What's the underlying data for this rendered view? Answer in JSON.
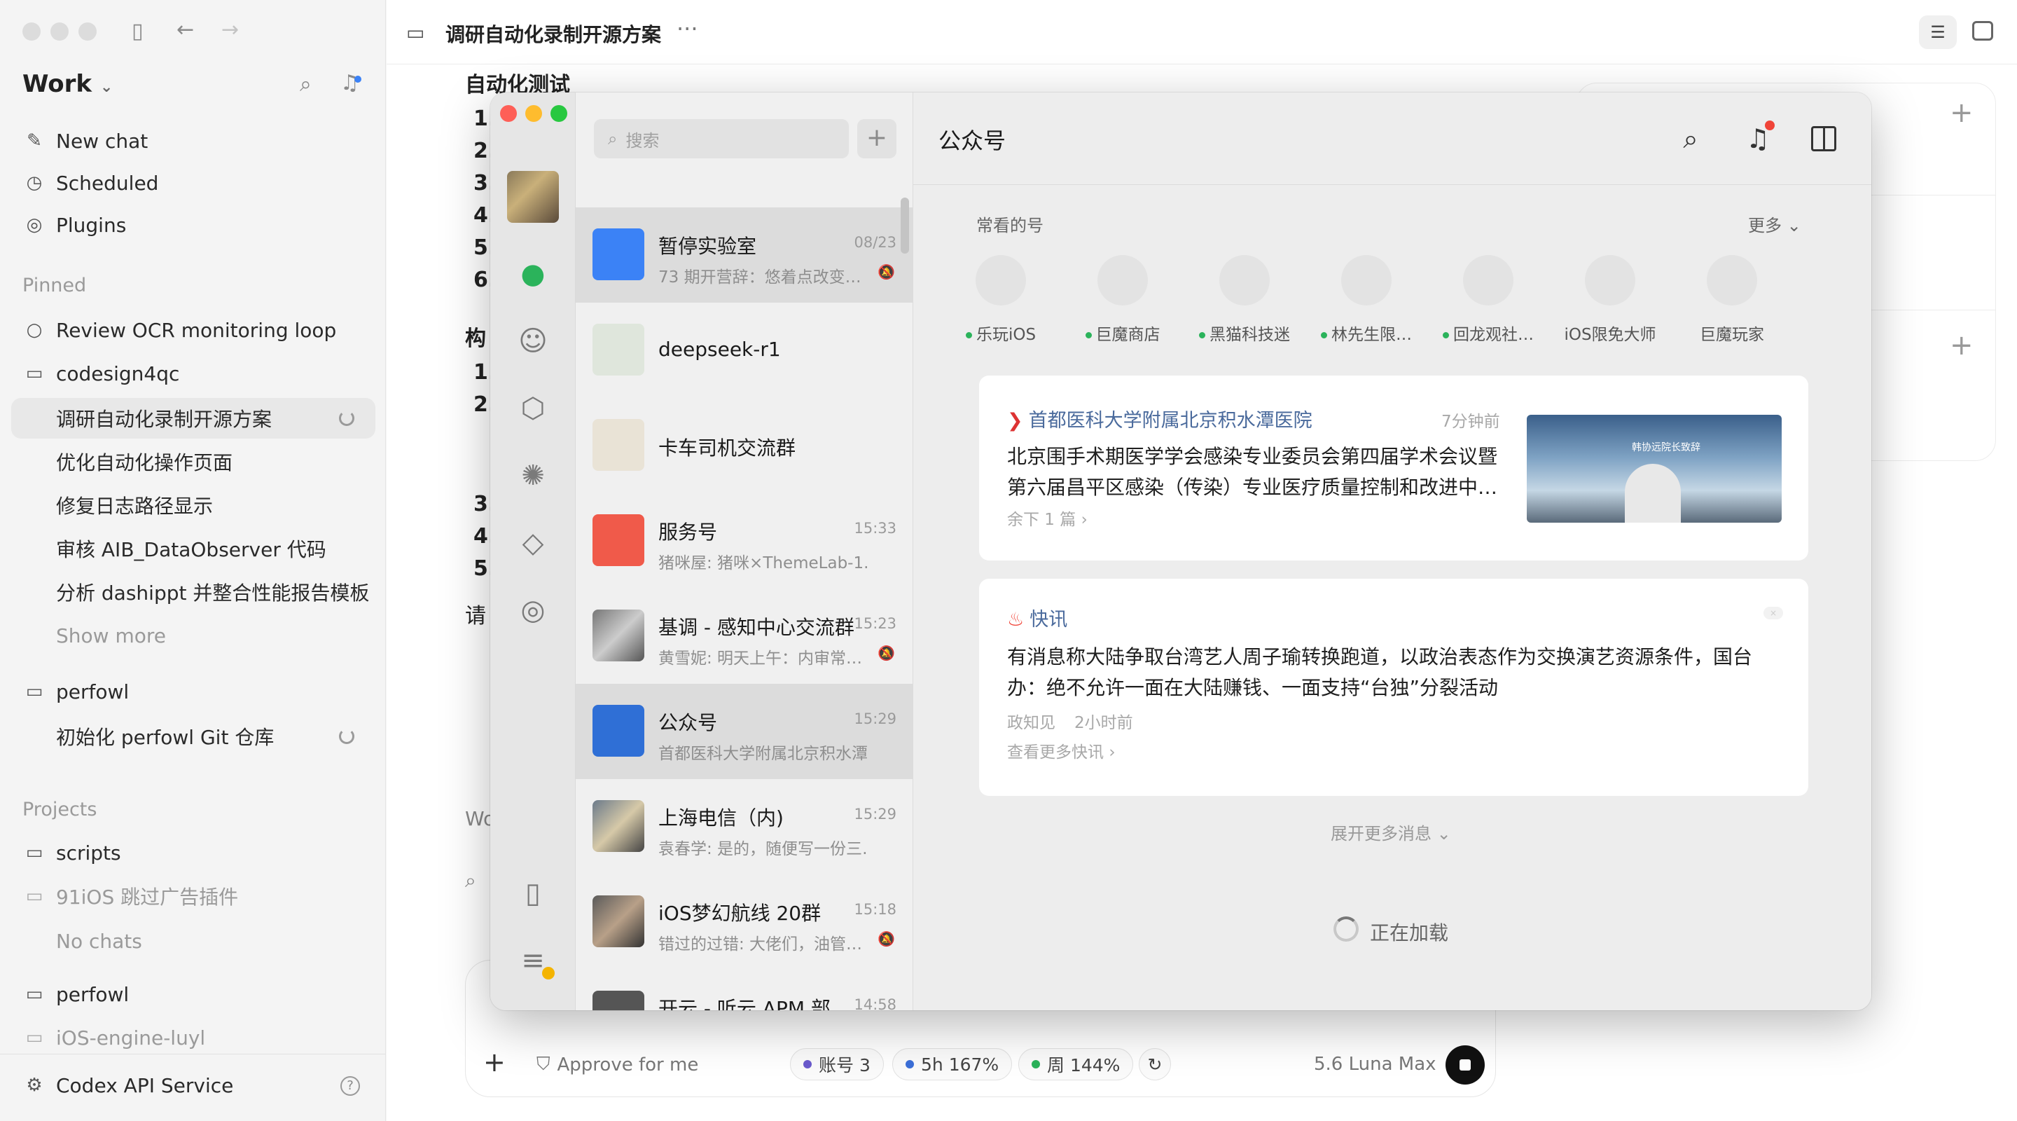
{
  "app": {
    "workspace": "Work",
    "nav": {
      "new_chat": "New chat",
      "scheduled": "Scheduled",
      "plugins": "Plugins"
    },
    "pinned_label": "Pinned",
    "pinned": {
      "review": "Review OCR monitoring loop",
      "folder": "codesign4qc",
      "children": [
        "调研自动化录制开源方案",
        "优化自动化操作页面",
        "修复日志路径显示",
        "审核 AIB_DataObserver 代码",
        "分析 dashippt 并整合性能报告模板"
      ],
      "show_more": "Show more"
    },
    "perfowl": {
      "folder": "perfowl",
      "child": "初始化 perfowl Git 仓库"
    },
    "projects_label": "Projects",
    "projects": {
      "scripts": "scripts",
      "ios_plugin": "91iOS 跳过广告插件",
      "no_chats": "No chats",
      "perfowl": "perfowl",
      "ios_engine": "iOS-engine-luyl"
    },
    "footer": "Codex API Service"
  },
  "doc": {
    "title": "调研自动化录制开源方案",
    "heading": "自动化测试",
    "list1": [
      "1.",
      "2.",
      "3.",
      "4.",
      "5.",
      "6."
    ],
    "heading2": "构",
    "list2": [
      "1.",
      "2."
    ],
    "list3": [
      "3.",
      "4.",
      "5."
    ],
    "trailing": "请",
    "wo": "Wo"
  },
  "composer": {
    "approve": "Approve for me",
    "chips": [
      {
        "label": "账号 3",
        "color": "#6a5acd"
      },
      {
        "label": "5h 167%",
        "color": "#3b6fd8"
      },
      {
        "label": "周 144%",
        "color": "#2bb35b"
      }
    ],
    "model": "5.6 Luna Max"
  },
  "wechat": {
    "search_placeholder": "搜索",
    "conversations": [
      {
        "name": "暂停实验室",
        "time": "08/23",
        "preview": "73 期开营辞：悠着点改变…",
        "muted": true,
        "selected": true
      },
      {
        "name": "deepseek-r1",
        "time": "",
        "preview": "",
        "muted": false
      },
      {
        "name": "卡车司机交流群",
        "time": "",
        "preview": "",
        "muted": false
      },
      {
        "name": "服务号",
        "time": "15:33",
        "preview": "猪咪屋: 猪咪×ThemeLab-1.7…",
        "muted": false
      },
      {
        "name": "基调 - 感知中心交流群",
        "time": "15:23",
        "preview": "黄雪妮: 明天上午：内审常…",
        "muted": true
      },
      {
        "name": "公众号",
        "time": "15:29",
        "preview": "首都医科大学附属北京积水潭…",
        "muted": false,
        "selected": true
      },
      {
        "name": "上海电信（内)",
        "time": "15:29",
        "preview": "袁春学: 是的，随便写一份三…",
        "muted": false
      },
      {
        "name": "iOS梦幻航线 20群",
        "time": "15:18",
        "preview": "错过的过错: 大佬们，油管…",
        "muted": true
      },
      {
        "name": "开云 - 听云 APM 部…",
        "time": "14:58",
        "preview": "",
        "muted": false
      }
    ],
    "main_title": "公众号",
    "frequent_label": "常看的号",
    "more_label": "更多",
    "accounts": [
      {
        "name": "乐玩iOS",
        "dot": true
      },
      {
        "name": "巨魔商店",
        "dot": true
      },
      {
        "name": "黑猫科技迷",
        "dot": true
      },
      {
        "name": "林先生限…",
        "dot": true
      },
      {
        "name": "回龙观社…",
        "dot": true
      },
      {
        "name": "iOS限免大师",
        "dot": false
      },
      {
        "name": "巨魔玩家",
        "dot": false
      }
    ],
    "article_card": {
      "source": "首都医科大学附属北京积水潭医院",
      "time": "7分钟前",
      "line1": "北京围手术期医学学会感染专业委员会第四届学术会议暨",
      "line2": "第六届昌平区感染（传染）专业医疗质量控制和改进中…",
      "remaining": "余下 1 篇",
      "thumb_caption": "韩协远院长致辞"
    },
    "flash_card": {
      "source": "快讯",
      "line1": "有消息称大陆争取台湾艺人周子瑜转换跑道，以政治表态作为交换演艺资源条件，国台",
      "line2": "办：绝不允许一面在大陆赚钱、一面支持“台独”分裂活动",
      "source_name": "政知见",
      "time": "2小时前",
      "more": "查看更多快讯"
    },
    "expand": "展开更多消息",
    "loading": "正在加载"
  }
}
